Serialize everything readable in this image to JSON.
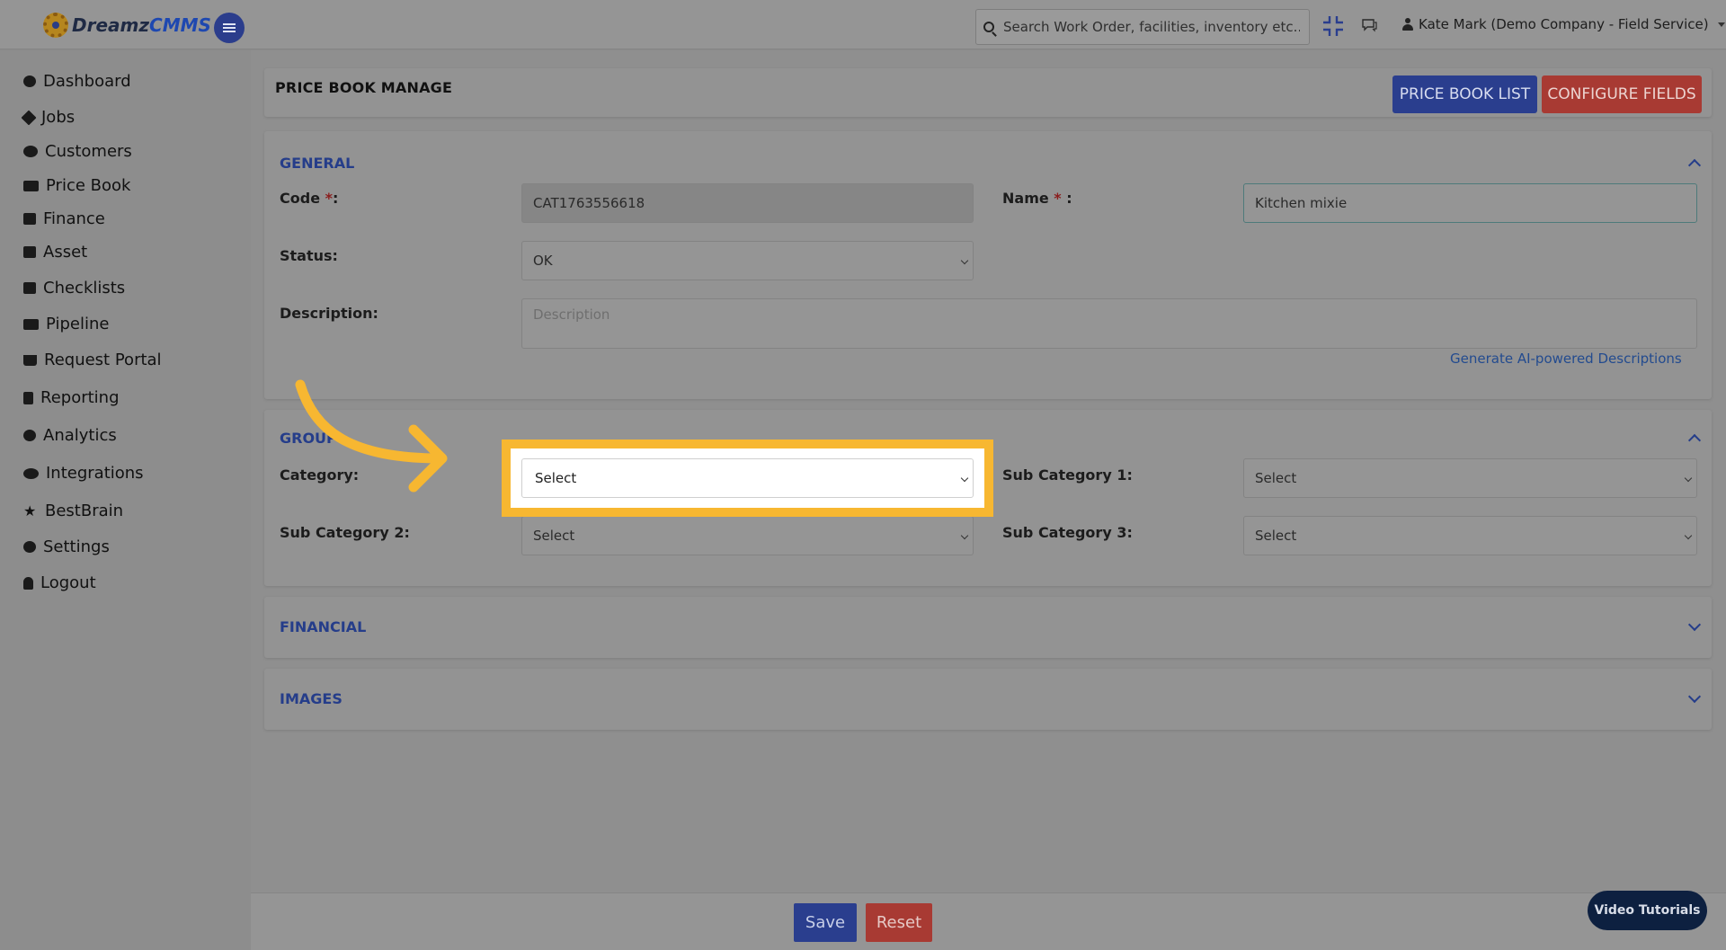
{
  "app": {
    "logo_prefix": "Dreamz",
    "logo_suffix": "CMMS"
  },
  "header": {
    "search_placeholder": "Search Work Order, facilities, inventory etc...",
    "user_label": "Kate Mark (Demo Company - Field Service)"
  },
  "sidebar": {
    "items": [
      {
        "label": "Dashboard",
        "icon": "dashboard-icon"
      },
      {
        "label": "Jobs",
        "icon": "wrench-icon"
      },
      {
        "label": "Customers",
        "icon": "users-icon"
      },
      {
        "label": "Price Book",
        "icon": "money-icon"
      },
      {
        "label": "Finance",
        "icon": "check-square-icon"
      },
      {
        "label": "Asset",
        "icon": "archive-icon"
      },
      {
        "label": "Checklists",
        "icon": "check-square-icon"
      },
      {
        "label": "Pipeline",
        "icon": "money-icon"
      },
      {
        "label": "Request Portal",
        "icon": "cart-icon"
      },
      {
        "label": "Reporting",
        "icon": "file-icon"
      },
      {
        "label": "Analytics",
        "icon": "dashboard-icon"
      },
      {
        "label": "Integrations",
        "icon": "cloud-icon"
      },
      {
        "label": "BestBrain",
        "icon": "star-icon"
      },
      {
        "label": "Settings",
        "icon": "gear-icon"
      },
      {
        "label": "Logout",
        "icon": "user-icon"
      }
    ]
  },
  "page": {
    "title": "PRICE BOOK MANAGE",
    "price_book_list": "PRICE BOOK LIST",
    "configure_fields": "CONFIGURE FIELDS"
  },
  "general": {
    "title": "GENERAL",
    "code_label": "Code",
    "code_value": "CAT1763556618",
    "name_label": "Name",
    "name_value": "Kitchen mixie",
    "status_label": "Status:",
    "status_value": "OK",
    "description_label": "Description:",
    "description_placeholder": "Description",
    "ai_link": "Generate AI-powered Descriptions",
    "required_mark": "*",
    "colon": ":",
    "name_colon": " :"
  },
  "group": {
    "title": "GROUP",
    "category_label": "Category:",
    "category_value": "Select",
    "sub1_label": "Sub Category 1:",
    "sub1_value": "Select",
    "sub2_label": "Sub Category 2:",
    "sub2_value": "Select",
    "sub3_label": "Sub Category 3:",
    "sub3_value": "Select"
  },
  "financial": {
    "title": "FINANCIAL"
  },
  "images": {
    "title": "IMAGES"
  },
  "footer": {
    "save": "Save",
    "reset": "Reset",
    "video_tutorials": "Video Tutorials"
  },
  "colors": {
    "highlight": "#f7b731",
    "primary": "#2a3e8e",
    "danger": "#a83a33"
  }
}
